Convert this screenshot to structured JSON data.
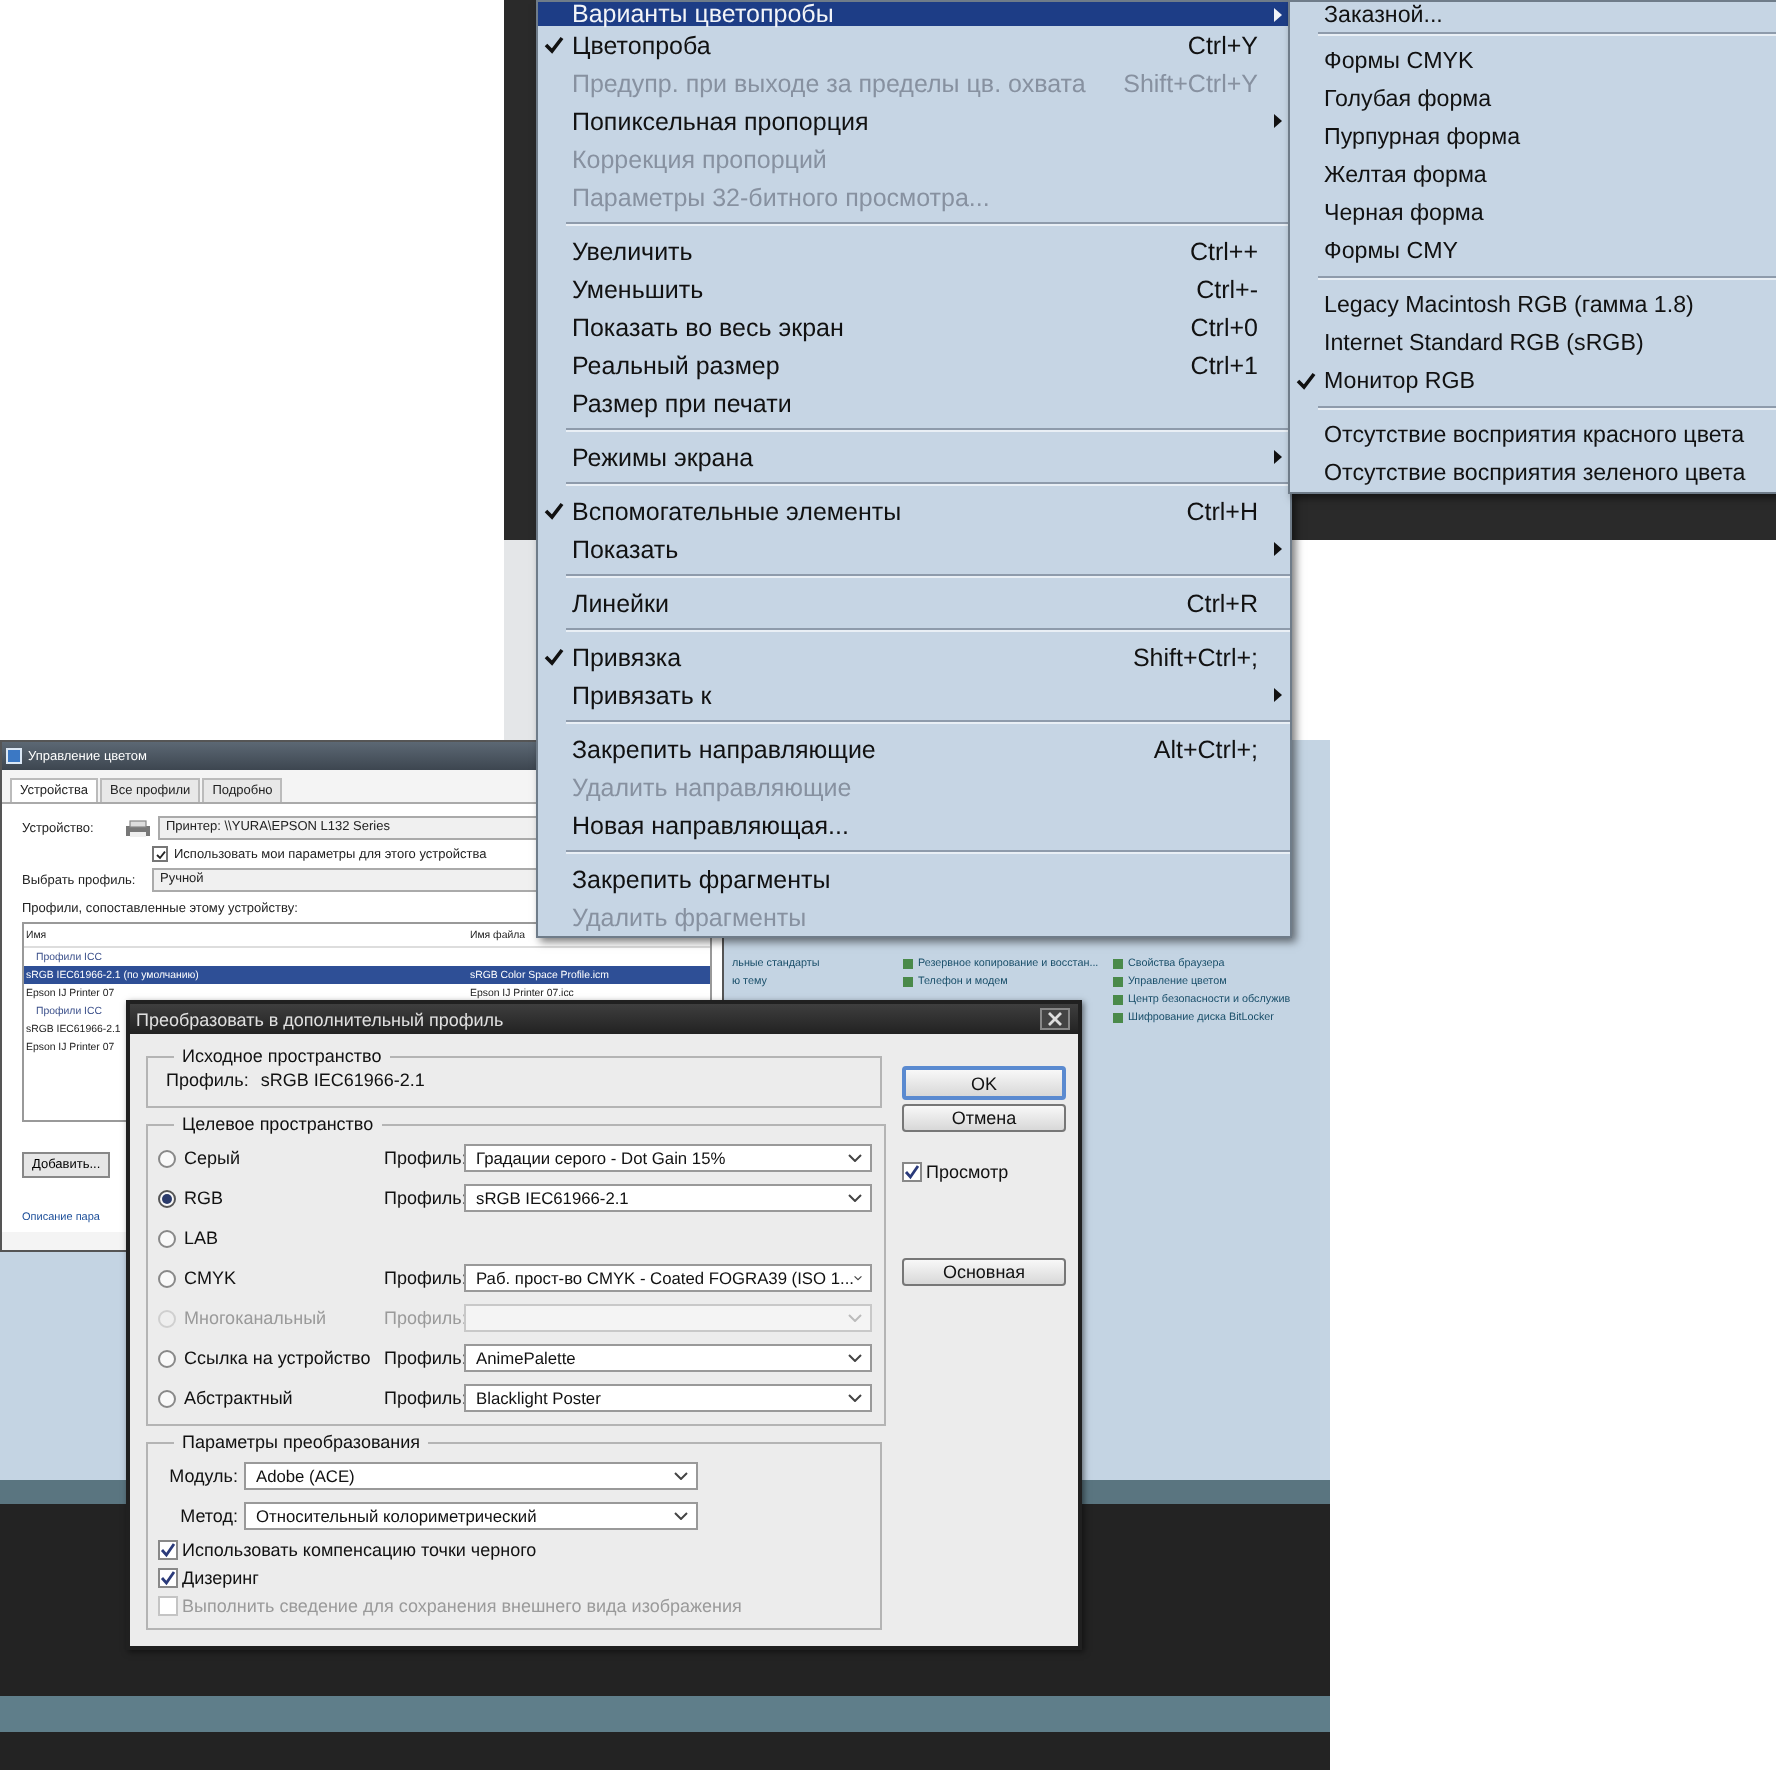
{
  "view_menu": {
    "items": [
      {
        "kind": "item",
        "label": "Варианты цветопробы",
        "checked": false,
        "disabled": false,
        "selected": true,
        "has_submenu": true
      },
      {
        "kind": "item",
        "label": "Цветопроба",
        "shortcut": "Ctrl+Y",
        "checked": true,
        "disabled": false,
        "selected": false,
        "has_submenu": false
      },
      {
        "kind": "item",
        "label": "Предупр. при выходе за пределы цв. охвата",
        "shortcut": "Shift+Ctrl+Y",
        "checked": false,
        "disabled": true,
        "selected": false,
        "has_submenu": false
      },
      {
        "kind": "item",
        "label": "Попиксельная пропорция",
        "checked": false,
        "disabled": false,
        "selected": false,
        "has_submenu": true
      },
      {
        "kind": "item",
        "label": "Коррекция пропорций",
        "checked": false,
        "disabled": true,
        "selected": false,
        "has_submenu": false
      },
      {
        "kind": "item",
        "label": "Параметры 32-битного просмотра...",
        "checked": false,
        "disabled": true,
        "selected": false,
        "has_submenu": false
      },
      {
        "kind": "separator"
      },
      {
        "kind": "item",
        "label": "Увеличить",
        "shortcut": "Ctrl++",
        "checked": false,
        "disabled": false,
        "selected": false,
        "has_submenu": false
      },
      {
        "kind": "item",
        "label": "Уменьшить",
        "shortcut": "Ctrl+-",
        "checked": false,
        "disabled": false,
        "selected": false,
        "has_submenu": false
      },
      {
        "kind": "item",
        "label": "Показать во весь экран",
        "shortcut": "Ctrl+0",
        "checked": false,
        "disabled": false,
        "selected": false,
        "has_submenu": false
      },
      {
        "kind": "item",
        "label": "Реальный размер",
        "shortcut": "Ctrl+1",
        "checked": false,
        "disabled": false,
        "selected": false,
        "has_submenu": false
      },
      {
        "kind": "item",
        "label": "Размер при печати",
        "checked": false,
        "disabled": false,
        "selected": false,
        "has_submenu": false
      },
      {
        "kind": "separator"
      },
      {
        "kind": "item",
        "label": "Режимы экрана",
        "checked": false,
        "disabled": false,
        "selected": false,
        "has_submenu": true
      },
      {
        "kind": "separator"
      },
      {
        "kind": "item",
        "label": "Вспомогательные элементы",
        "shortcut": "Ctrl+H",
        "checked": true,
        "disabled": false,
        "selected": false,
        "has_submenu": false
      },
      {
        "kind": "item",
        "label": "Показать",
        "checked": false,
        "disabled": false,
        "selected": false,
        "has_submenu": true
      },
      {
        "kind": "separator"
      },
      {
        "kind": "item",
        "label": "Линейки",
        "shortcut": "Ctrl+R",
        "checked": false,
        "disabled": false,
        "selected": false,
        "has_submenu": false
      },
      {
        "kind": "separator"
      },
      {
        "kind": "item",
        "label": "Привязка",
        "shortcut": "Shift+Ctrl+;",
        "checked": true,
        "disabled": false,
        "selected": false,
        "has_submenu": false
      },
      {
        "kind": "item",
        "label": "Привязать к",
        "checked": false,
        "disabled": false,
        "selected": false,
        "has_submenu": true
      },
      {
        "kind": "separator"
      },
      {
        "kind": "item",
        "label": "Закрепить направляющие",
        "shortcut": "Alt+Ctrl+;",
        "checked": false,
        "disabled": false,
        "selected": false,
        "has_submenu": false
      },
      {
        "kind": "item",
        "label": "Удалить направляющие",
        "checked": false,
        "disabled": true,
        "selected": false,
        "has_submenu": false
      },
      {
        "kind": "item",
        "label": "Новая направляющая...",
        "checked": false,
        "disabled": false,
        "selected": false,
        "has_submenu": false
      },
      {
        "kind": "separator"
      },
      {
        "kind": "item",
        "label": "Закрепить фрагменты",
        "checked": false,
        "disabled": false,
        "selected": false,
        "has_submenu": false
      },
      {
        "kind": "item",
        "label": "Удалить фрагменты",
        "checked": false,
        "disabled": true,
        "selected": false,
        "has_submenu": false
      }
    ]
  },
  "proof_submenu": {
    "items": [
      {
        "kind": "item",
        "label": "Заказной...",
        "checked": false,
        "disabled": false,
        "selected": false,
        "has_submenu": false
      },
      {
        "kind": "separator"
      },
      {
        "kind": "item",
        "label": "Формы CMYK",
        "checked": false,
        "disabled": false,
        "selected": false,
        "has_submenu": false
      },
      {
        "kind": "item",
        "label": "Голубая форма",
        "checked": false,
        "disabled": false,
        "selected": false,
        "has_submenu": false
      },
      {
        "kind": "item",
        "label": "Пурпурная форма",
        "checked": false,
        "disabled": false,
        "selected": false,
        "has_submenu": false
      },
      {
        "kind": "item",
        "label": "Желтая форма",
        "checked": false,
        "disabled": false,
        "selected": false,
        "has_submenu": false
      },
      {
        "kind": "item",
        "label": "Черная форма",
        "checked": false,
        "disabled": false,
        "selected": false,
        "has_submenu": false
      },
      {
        "kind": "item",
        "label": "Формы CMY",
        "checked": false,
        "disabled": false,
        "selected": false,
        "has_submenu": false
      },
      {
        "kind": "separator"
      },
      {
        "kind": "item",
        "label": "Legacy Macintosh RGB (гамма 1.8)",
        "checked": false,
        "disabled": false,
        "selected": false,
        "has_submenu": false
      },
      {
        "kind": "item",
        "label": "Internet Standard RGB (sRGB)",
        "checked": false,
        "disabled": false,
        "selected": false,
        "has_submenu": false
      },
      {
        "kind": "item",
        "label": "Монитор RGB",
        "checked": true,
        "disabled": false,
        "selected": false,
        "has_submenu": false
      },
      {
        "kind": "separator"
      },
      {
        "kind": "item",
        "label": "Отсутствие восприятия красного цвета",
        "checked": false,
        "disabled": false,
        "selected": false,
        "has_submenu": false
      },
      {
        "kind": "item",
        "label": "Отсутствие восприятия зеленого цвета",
        "checked": false,
        "disabled": false,
        "selected": false,
        "has_submenu": false
      }
    ]
  },
  "color_management": {
    "title": "Управление цветом",
    "tabs": [
      {
        "label": "Устройства",
        "selected": true
      },
      {
        "label": "Все профили",
        "selected": false
      },
      {
        "label": "Подробно",
        "selected": false
      }
    ],
    "device_label": "Устройство:",
    "device": "Принтер: \\\\YURA\\EPSON L132 Series",
    "use_settings": {
      "label": "Использовать мои параметры для этого устройства",
      "checked": true
    },
    "profile_choice_label": "Выбрать профиль:",
    "profile_choice": "Ручной",
    "list_caption": "Профили, сопоставленные этому устройству:",
    "columns": [
      "Имя",
      "Имя файла"
    ],
    "rows": [
      {
        "kind": "group",
        "name": "Профили ICC"
      },
      {
        "kind": "profile",
        "name": "sRGB IEC61966-2.1 (по умолчанию)",
        "file": "sRGB Color Space Profile.icm",
        "selected": true
      },
      {
        "kind": "profile",
        "name": "Epson IJ Printer 07",
        "file": "Epson IJ Printer 07.icc",
        "selected": false
      },
      {
        "kind": "group",
        "name": "Профили ICC"
      },
      {
        "kind": "profile",
        "name": "sRGB IEC61966-2.1",
        "selected": false
      },
      {
        "kind": "profile",
        "name": "Epson IJ Printer 07",
        "selected": false
      }
    ],
    "buttons": [
      "Добавить..."
    ],
    "link": "Описание пара"
  },
  "control_panel": {
    "columns": [
      {
        "kind": "plain",
        "links": [
          "льные стандарты",
          "ю тему"
        ]
      },
      {
        "kind": "with_icons",
        "links": [
          "Резервное копирование и восстан...",
          "Телефон и модем"
        ]
      },
      {
        "kind": "with_icons",
        "links": [
          "Свойства браузера",
          "Управление цветом",
          "Центр безопасности и обслужив",
          "Шифрование диска BitLocker"
        ]
      }
    ]
  },
  "convert_dialog": {
    "title": "Преобразовать в дополнительный профиль",
    "source": {
      "title": "Исходное пространство",
      "profile_label": "Профиль:",
      "profile": "sRGB IEC61966-2.1"
    },
    "target": {
      "title": "Целевое пространство",
      "options": [
        {
          "label": "Серый",
          "selected": false,
          "disabled": false,
          "profile_label": "Профиль:",
          "profile": "Градации серого - Dot Gain 15%"
        },
        {
          "label": "RGB",
          "selected": true,
          "disabled": false,
          "profile_label": "Профиль:",
          "profile": "sRGB IEC61966-2.1"
        },
        {
          "label": "LAB",
          "selected": false,
          "disabled": false
        },
        {
          "label": "CMYK",
          "selected": false,
          "disabled": false,
          "profile_label": "Профиль:",
          "profile": "Раб. прост-во CMYK - Coated FOGRA39 (ISO 1..."
        },
        {
          "label": "Многоканальный",
          "selected": false,
          "disabled": true,
          "profile_label": "Профиль:"
        },
        {
          "label": "Ссылка на устройство",
          "selected": false,
          "disabled": false,
          "profile_label": "Профиль:",
          "profile": "AnimePalette"
        },
        {
          "label": "Абстрактный",
          "selected": false,
          "disabled": false,
          "profile_label": "Профиль:",
          "profile": "Blacklight Poster"
        }
      ]
    },
    "conversion": {
      "title": "Параметры преобразования",
      "fields": [
        {
          "label": "Модуль:",
          "value": "Adobe (ACE)"
        },
        {
          "label": "Метод:",
          "value": "Относительный колориметрический"
        }
      ],
      "options": [
        {
          "label": "Использовать компенсацию точки черного",
          "checked": true,
          "disabled": false
        },
        {
          "label": "Дизеринг",
          "checked": true,
          "disabled": false
        },
        {
          "label": "Выполнить сведение для сохранения внешнего вида изображения",
          "checked": false,
          "disabled": true
        }
      ]
    },
    "side": [
      {
        "kind": "button",
        "label": "OK",
        "default": true
      },
      {
        "kind": "button",
        "label": "Отмена",
        "default": false
      },
      {
        "kind": "checkbox",
        "label": "Просмотр",
        "checked": true
      },
      {
        "kind": "button",
        "label": "Основная",
        "default": false
      }
    ]
  }
}
